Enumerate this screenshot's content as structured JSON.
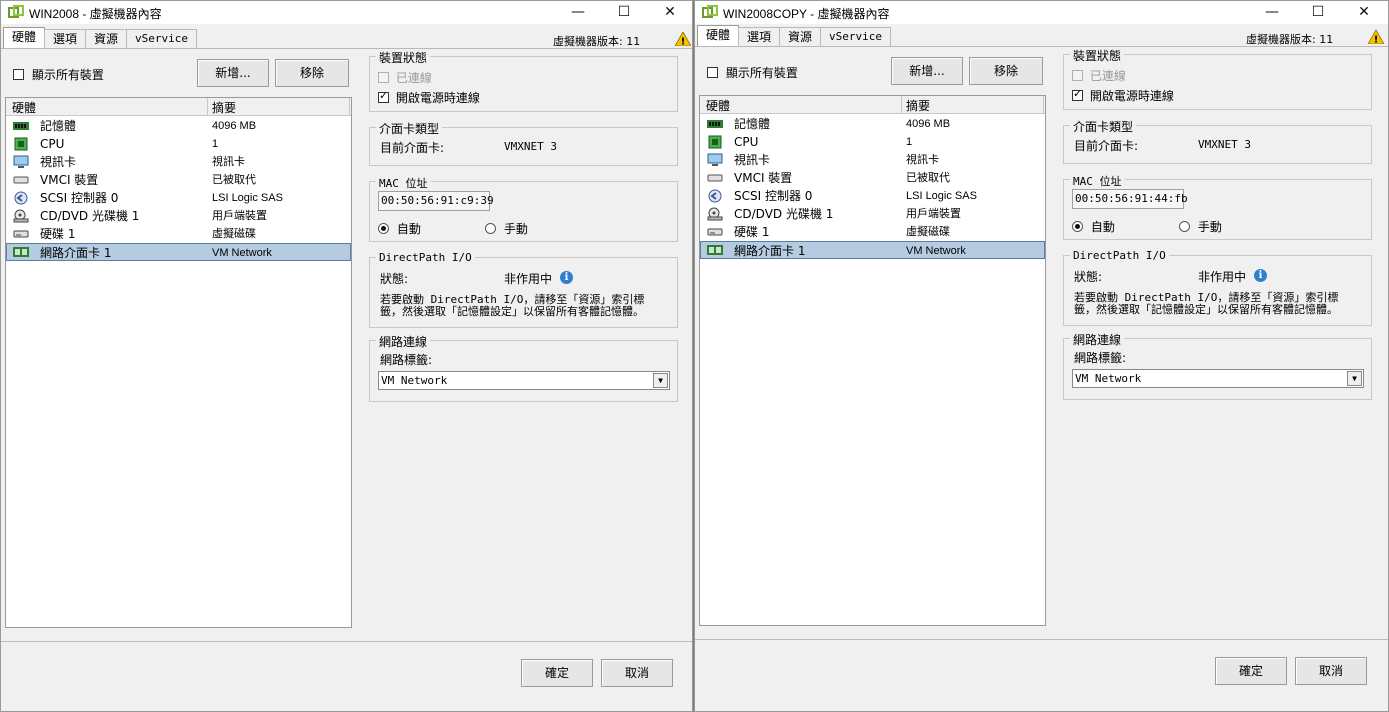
{
  "windows": [
    {
      "title": "WIN2008 - 虛擬機器內容",
      "tabs": [
        "硬體",
        "選項",
        "資源",
        "vService"
      ],
      "version_label": "虛擬機器版本: 11",
      "show_all_devices": "顯示所有裝置",
      "add_button": "新增...",
      "remove_button": "移除",
      "table_headers": {
        "hardware": "硬體",
        "summary": "摘要"
      },
      "devices": [
        {
          "name": "記憶體",
          "summary": "4096 MB",
          "icon": "memory-icon"
        },
        {
          "name": "CPU",
          "summary": "1",
          "icon": "cpu-icon"
        },
        {
          "name": "視訊卡",
          "summary": "視訊卡",
          "icon": "video-card-icon"
        },
        {
          "name": "VMCI 裝置",
          "summary": "已被取代",
          "icon": "vmci-icon"
        },
        {
          "name": "SCSI 控制器 0",
          "summary": "LSI Logic SAS",
          "icon": "scsi-controller-icon"
        },
        {
          "name": "CD/DVD 光碟機 1",
          "summary": "用戶端裝置",
          "icon": "cd-dvd-icon"
        },
        {
          "name": "硬碟 1",
          "summary": "虛擬磁碟",
          "icon": "hard-disk-icon"
        },
        {
          "name": "網路介面卡 1",
          "summary": "VM Network",
          "icon": "network-adapter-icon"
        }
      ],
      "device_status": {
        "title": "裝置狀態",
        "connected": "已連線",
        "connect_at_power_on": "開啟電源時連線"
      },
      "adapter_type": {
        "title": "介面卡類型",
        "current_label": "目前介面卡:",
        "current_value": "VMXNET 3"
      },
      "mac": {
        "title": "MAC 位址",
        "value": "00:50:56:91:c9:39",
        "auto": "自動",
        "manual": "手動"
      },
      "directpath": {
        "title": "DirectPath I/O",
        "status_label": "狀態:",
        "status_value": "非作用中",
        "note_line1": "若要啟動 DirectPath I/O，請移至「資源」索引標",
        "note_line2": "籤，然後選取「記憶體設定」以保留所有客體記憶體。"
      },
      "network": {
        "title": "網路連線",
        "label_title": "網路標籤:",
        "selected": "VM Network"
      },
      "ok_button": "確定",
      "cancel_button": "取消"
    },
    {
      "title": "WIN2008COPY - 虛擬機器內容",
      "tabs": [
        "硬體",
        "選項",
        "資源",
        "vService"
      ],
      "version_label": "虛擬機器版本: 11",
      "show_all_devices": "顯示所有裝置",
      "add_button": "新增...",
      "remove_button": "移除",
      "table_headers": {
        "hardware": "硬體",
        "summary": "摘要"
      },
      "devices": [
        {
          "name": "記憶體",
          "summary": "4096 MB",
          "icon": "memory-icon"
        },
        {
          "name": "CPU",
          "summary": "1",
          "icon": "cpu-icon"
        },
        {
          "name": "視訊卡",
          "summary": "視訊卡",
          "icon": "video-card-icon"
        },
        {
          "name": "VMCI 裝置",
          "summary": "已被取代",
          "icon": "vmci-icon"
        },
        {
          "name": "SCSI 控制器 0",
          "summary": "LSI Logic SAS",
          "icon": "scsi-controller-icon"
        },
        {
          "name": "CD/DVD 光碟機 1",
          "summary": "用戶端裝置",
          "icon": "cd-dvd-icon"
        },
        {
          "name": "硬碟 1",
          "summary": "虛擬磁碟",
          "icon": "hard-disk-icon"
        },
        {
          "name": "網路介面卡 1",
          "summary": "VM Network",
          "icon": "network-adapter-icon"
        }
      ],
      "device_status": {
        "title": "裝置狀態",
        "connected": "已連線",
        "connect_at_power_on": "開啟電源時連線"
      },
      "adapter_type": {
        "title": "介面卡類型",
        "current_label": "目前介面卡:",
        "current_value": "VMXNET 3"
      },
      "mac": {
        "title": "MAC 位址",
        "value": "00:50:56:91:44:fb",
        "auto": "自動",
        "manual": "手動"
      },
      "directpath": {
        "title": "DirectPath I/O",
        "status_label": "狀態:",
        "status_value": "非作用中",
        "note_line1": "若要啟動 DirectPath I/O，請移至「資源」索引標",
        "note_line2": "籤，然後選取「記憶體設定」以保留所有客體記憶體。"
      },
      "network": {
        "title": "網路連線",
        "label_title": "網路標籤:",
        "selected": "VM Network"
      },
      "ok_button": "確定",
      "cancel_button": "取消"
    }
  ],
  "colors": {
    "selection": "#b4cbe0",
    "info_blue": "#2f7fd1",
    "warning_yellow": "#f5c400"
  }
}
